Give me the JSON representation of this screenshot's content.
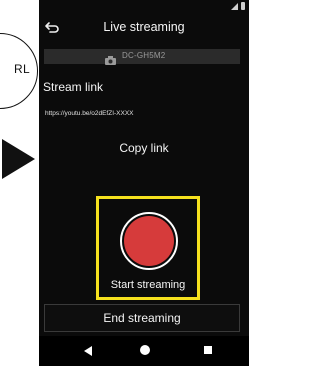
{
  "illustration": {
    "bubble_text": "RL"
  },
  "header": {
    "title": "Live streaming"
  },
  "camera": {
    "model": "DC-GH5M2"
  },
  "stream_link": {
    "title": "Stream link",
    "url": "https://youtu.be/o2dEfZI-XXXX",
    "copy_label": "Copy link"
  },
  "controls": {
    "start_label": "Start streaming",
    "end_label": "End streaming"
  },
  "colors": {
    "highlight": "#f5e11e",
    "record": "#d63b3b",
    "background": "#0b0b0b"
  }
}
